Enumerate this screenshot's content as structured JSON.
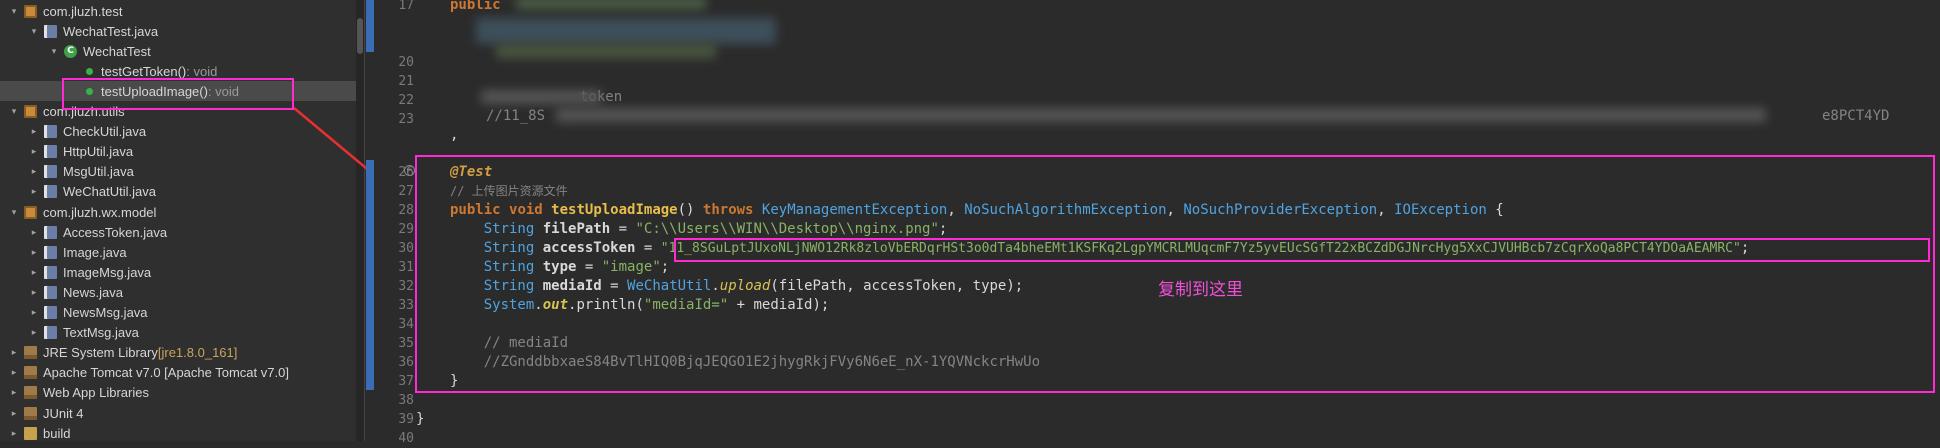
{
  "explorer": {
    "rows": [
      {
        "indent": 0,
        "twisty": "▾",
        "icon": "package-icon",
        "icon_kind": "pkg",
        "label": "com.jluzh.test"
      },
      {
        "indent": 1,
        "twisty": "▾",
        "icon": "java-file-icon",
        "icon_kind": "java",
        "label": "WechatTest.java"
      },
      {
        "indent": 2,
        "twisty": "▾",
        "icon": "class-icon",
        "icon_kind": "cls",
        "label": "WechatTest"
      },
      {
        "indent": 3,
        "twisty": "",
        "icon": "method-icon",
        "icon_kind": "method",
        "label": "testGetToken()",
        "suffix": " : void"
      },
      {
        "indent": 3,
        "twisty": "",
        "icon": "method-icon",
        "icon_kind": "method",
        "label": "testUploadImage()",
        "suffix": " : void",
        "selected": true
      },
      {
        "indent": 0,
        "twisty": "▾",
        "icon": "package-icon",
        "icon_kind": "pkg",
        "label": "com.jluzh.utils"
      },
      {
        "indent": 1,
        "twisty": "▸",
        "icon": "java-file-icon",
        "icon_kind": "java",
        "label": "CheckUtil.java"
      },
      {
        "indent": 1,
        "twisty": "▸",
        "icon": "java-file-icon",
        "icon_kind": "java",
        "label": "HttpUtil.java"
      },
      {
        "indent": 1,
        "twisty": "▸",
        "icon": "java-file-icon",
        "icon_kind": "java",
        "label": "MsgUtil.java"
      },
      {
        "indent": 1,
        "twisty": "▸",
        "icon": "java-file-icon",
        "icon_kind": "java",
        "label": "WeChatUtil.java"
      },
      {
        "indent": 0,
        "twisty": "▾",
        "icon": "package-icon",
        "icon_kind": "pkg",
        "label": "com.jluzh.wx.model"
      },
      {
        "indent": 1,
        "twisty": "▸",
        "icon": "java-file-icon",
        "icon_kind": "java",
        "label": "AccessToken.java"
      },
      {
        "indent": 1,
        "twisty": "▸",
        "icon": "java-file-icon",
        "icon_kind": "java",
        "label": "Image.java"
      },
      {
        "indent": 1,
        "twisty": "▸",
        "icon": "java-file-icon",
        "icon_kind": "java",
        "label": "ImageMsg.java"
      },
      {
        "indent": 1,
        "twisty": "▸",
        "icon": "java-file-icon",
        "icon_kind": "java",
        "label": "News.java"
      },
      {
        "indent": 1,
        "twisty": "▸",
        "icon": "java-file-icon",
        "icon_kind": "java",
        "label": "NewsMsg.java"
      },
      {
        "indent": 1,
        "twisty": "▸",
        "icon": "java-file-icon",
        "icon_kind": "java",
        "label": "TextMsg.java"
      },
      {
        "indent": 0,
        "twisty": "▸",
        "icon": "library-icon",
        "icon_kind": "lib",
        "label": "JRE System Library",
        "suffix": " [jre1.8.0_161]",
        "suffix_class": "jre"
      },
      {
        "indent": 0,
        "twisty": "▸",
        "icon": "library-icon",
        "icon_kind": "lib",
        "label": "Apache Tomcat v7.0 [Apache Tomcat v7.0]"
      },
      {
        "indent": 0,
        "twisty": "▸",
        "icon": "library-icon",
        "icon_kind": "lib",
        "label": "Web App Libraries"
      },
      {
        "indent": 0,
        "twisty": "▸",
        "icon": "library-icon",
        "icon_kind": "lib",
        "label": "JUnit 4"
      },
      {
        "indent": 0,
        "twisty": "▸",
        "icon": "folder-icon",
        "icon_kind": "folder",
        "label": "build"
      }
    ]
  },
  "editor": {
    "line_numbers": [
      "17",
      "",
      "",
      "20",
      "21",
      "22",
      "23",
      "",
      "",
      "26",
      "27",
      "28",
      "29",
      "30",
      "31",
      "32",
      "33",
      "34",
      "35",
      "36",
      "37",
      "38",
      "39",
      "40"
    ],
    "visible_fragments": {
      "l17": "public",
      "l22": "token",
      "l23": "//11_8S",
      "l23_tail": "e8PCT4YD"
    },
    "code": {
      "l26_annotation": "@Test",
      "l27_comment": "// 上传图片资源文件",
      "l28_public": "public",
      "l28_void": "void",
      "l28_method": "testUploadImage",
      "l28_parens": "() ",
      "l28_throws": "throws",
      "l28_ex1": "KeyManagementException",
      "l28_ex2": "NoSuchAlgorithmException",
      "l28_ex3": "NoSuchProviderException",
      "l28_ex4": "IOException",
      "l28_brace": " {",
      "l29_type": "String",
      "l29_var": "filePath",
      "l29_eq": " = ",
      "l29_val": "\"C:\\\\Users\\\\WIN\\\\Desktop\\\\nginx.png\"",
      "l29_end": ";",
      "l30_type": "String",
      "l30_var": "accessToken",
      "l30_eq": " = ",
      "l30_val": "\"11_8SGuLptJUxoNLjNWO12Rk8zloVbERDqrHSt3o0dTa4bheEMt1KSFKq2LgpYMCRLMUqcmF7Yz5yvEUcSGfT22xBCZdDGJNrcHyg5XxCJVUHBcb7zCqrXoQa8PCT4YDOaAEAMRC\"",
      "l30_end": ";",
      "l31_type": "String",
      "l31_var": "type",
      "l31_eq": " = ",
      "l31_val": "\"image\"",
      "l31_end": ";",
      "l32_type": "String",
      "l32_var": "mediaId",
      "l32_eq": " = ",
      "l32_cls": "WeChatUtil",
      "l32_dot": ".",
      "l32_call": "upload",
      "l32_args": "(filePath, accessToken, type);",
      "l33_sys": "System",
      "l33_dot": ".",
      "l33_out": "out",
      "l33_rest": ".println(",
      "l33_str": "\"mediaId=\"",
      "l33_tail": " + mediaId);",
      "l35_comment": "// mediaId",
      "l36_comment": "//ZGnddbbxaeS84BvTlHIQ0BjqJEQGO1E2jhygRkjFVy6N6eE_nX-1YQVNckcrHwUo",
      "l37_brace": "}",
      "l39_brace": "}"
    },
    "annotation_text": "复制到这里"
  },
  "colors": {
    "highlight": "#ff2ad4",
    "keyword": "#cc7832",
    "string": "#88b365",
    "type": "#4fa3e0",
    "comment": "#848484"
  }
}
